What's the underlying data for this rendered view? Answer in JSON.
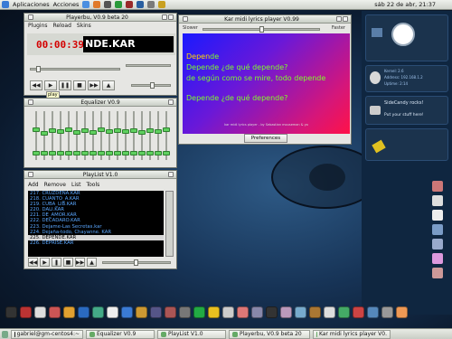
{
  "topbar": {
    "menu1": "Aplicaciones",
    "menu2": "Acciones",
    "clock": "sáb 22 de abr, 21:37"
  },
  "player": {
    "title": "Playerbu, V0.9 beta 20",
    "menu": [
      "Plugins",
      "Reload",
      "Skins"
    ],
    "time": "00:00:39",
    "song": "NDE.KAR",
    "play_tip": "play"
  },
  "equalizer": {
    "title": "Equalizer V0.9",
    "bands": [
      0.62,
      0.55,
      0.6,
      0.58,
      0.63,
      0.57,
      0.6,
      0.56,
      0.62,
      0.58,
      0.6,
      0.59,
      0.61,
      0.57,
      0.6,
      0.58,
      0.62
    ]
  },
  "playlist": {
    "title": "PlayList V1.0",
    "menu": [
      "Add",
      "Remove",
      "List",
      "Tools"
    ],
    "items": [
      "217. CRUZDENA.KAR",
      "218. CUANTO_A.KAR",
      "219. CUBA_LIB.KAR",
      "220. DALI.KAR",
      "221. DE_AMOR.KAR",
      "222. DECADARO.KAR",
      "223. Dejame-Las Secretas.kar",
      "224. Dejaña-todo, Chayanne. KAR",
      "225. DEPENDE.KAR",
      "226. DEPRISE.KAR"
    ],
    "selected_index": 8
  },
  "karaoke": {
    "title": "Kar midi lyrics player V0.99",
    "left_label": "Slower",
    "right_label": "Faster",
    "line1_sung": "Depen",
    "line1_rest": "de",
    "line2": "Depende ¿de qué depende?",
    "line3": "de según como se mire, todo depende",
    "line4": "Depende ¿de qué depende?",
    "credits": "kar midi lyrics player - by Sebastian mouseman & yo",
    "prefs": "Preferences"
  },
  "widgets": {
    "sys1": "Kernel: 2.6",
    "sys2": "Address: 192.168.1.2",
    "sys3": "Uptime: 2:14",
    "candy1": "SideCandy rocks!",
    "candy2": "Put your stuff here!"
  },
  "taskbar": {
    "items": [
      "gabriel@gm-centos4:~",
      "Equalizer V0.9",
      "PlayList V1.0",
      "Playerbu, V0.9 beta 20",
      "Kar midi lyrics player V0."
    ]
  },
  "colors": {
    "lcd_text": "#d40000",
    "karaoke_sung": "#ffd800",
    "karaoke_text": "#7dff2a",
    "playlist_text": "#5aa7ff"
  }
}
